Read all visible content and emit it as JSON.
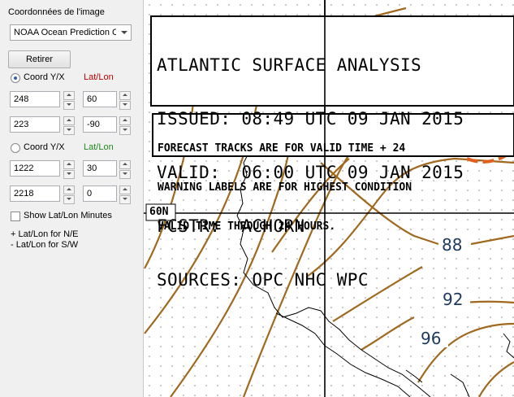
{
  "panel": {
    "group_title": "Coordonnées de l'image",
    "dropdown_value": "NOAA Ocean Prediction Ce",
    "button_label": "Retirer",
    "coord1": {
      "label": "Coord Y/X",
      "latlon_label": "Lat/Lon",
      "y": "248",
      "x": "223",
      "lat": "60",
      "lon": "-90"
    },
    "coord2": {
      "label": "Coord Y/X",
      "latlon_label": "Lat/Lon",
      "y": "1222",
      "x": "2218",
      "lat": "30",
      "lon": "0"
    },
    "show_minutes_label": "Show Lat/Lon Minutes",
    "hint1": "+ Lat/Lon for N/E",
    "hint2": "- Lat/Lon for S/W"
  },
  "map": {
    "title_lines": [
      "ATLANTIC SURFACE ANALYSIS",
      "ISSUED: 08:49 UTC 09 JAN 2015",
      "VALID:  06:00 UTC 09 JAN 2015",
      "FCSTR:  ACHORN",
      "SOURCES: OPC NHC WPC"
    ],
    "note_lines": [
      "FORECAST TRACKS ARE FOR VALID TIME + 24",
      "WARNING LABELS ARE FOR HIGHEST CONDITION",
      "VALID TIME THROUGH 24 HOURS."
    ],
    "lat_label": "60N",
    "isobars": [
      "88",
      "92",
      "96"
    ],
    "colors": {
      "isobar": "#a0691e",
      "isobar_label": "#1c3a5e",
      "front": "#e06020"
    }
  }
}
